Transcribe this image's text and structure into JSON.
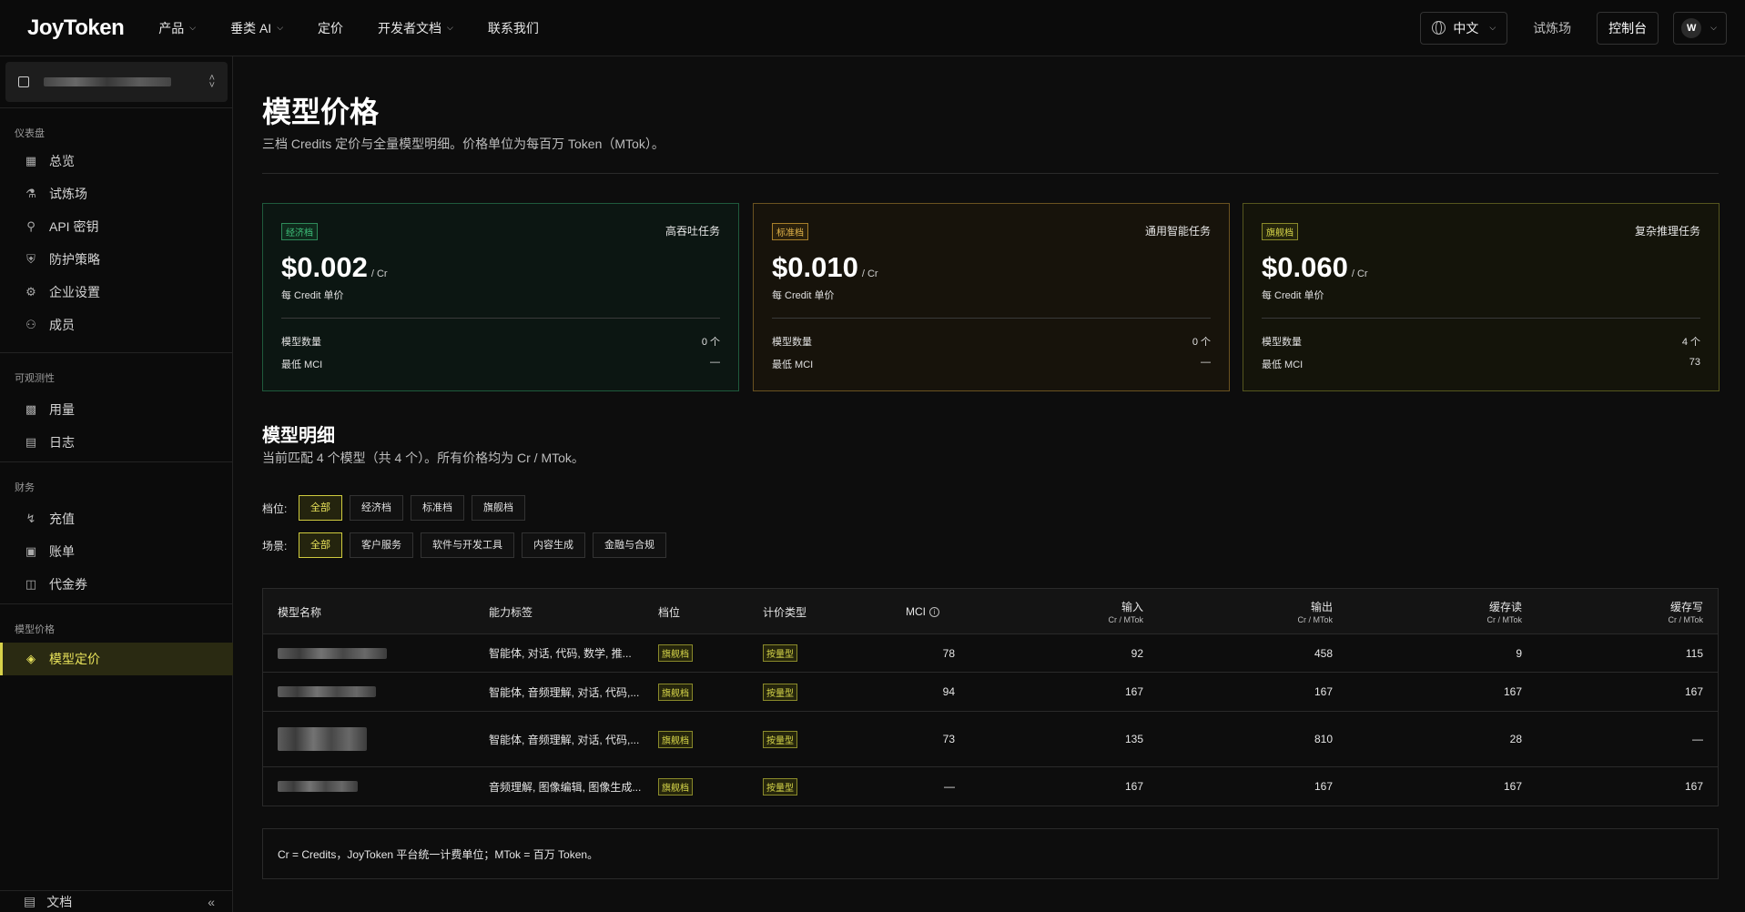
{
  "app": {
    "logo": "JoyToken"
  },
  "nav": [
    {
      "label": "产品",
      "has_menu": true
    },
    {
      "label": "垂类 AI",
      "has_menu": true
    },
    {
      "label": "定价",
      "has_menu": false
    },
    {
      "label": "开发者文档",
      "has_menu": true
    },
    {
      "label": "联系我们",
      "has_menu": false
    }
  ],
  "topright": {
    "lang": "中文",
    "playground": "试炼场",
    "console": "控制台",
    "avatar": "W"
  },
  "sidebar": {
    "groups": [
      {
        "title": "仪表盘",
        "items": [
          {
            "label": "总览",
            "icon": "grid-icon"
          },
          {
            "label": "试炼场",
            "icon": "flask-icon"
          },
          {
            "label": "API 密钥",
            "icon": "key-icon"
          },
          {
            "label": "防护策略",
            "icon": "shield-icon"
          },
          {
            "label": "企业设置",
            "icon": "gear-icon"
          },
          {
            "label": "成员",
            "icon": "users-icon"
          }
        ]
      },
      {
        "title": "可观测性",
        "items": [
          {
            "label": "用量",
            "icon": "bar-chart-icon"
          },
          {
            "label": "日志",
            "icon": "log-icon"
          }
        ]
      },
      {
        "title": "财务",
        "items": [
          {
            "label": "充值",
            "icon": "bolt-icon"
          },
          {
            "label": "账单",
            "icon": "bill-icon"
          },
          {
            "label": "代金券",
            "icon": "gift-icon"
          }
        ]
      },
      {
        "title": "模型价格",
        "items": [
          {
            "label": "模型定价",
            "icon": "tag-icon",
            "active": true
          }
        ]
      }
    ],
    "bottom": {
      "label": "文档"
    }
  },
  "page": {
    "title": "模型价格",
    "subtitle": "三档 Credits 定价与全量模型明细。价格单位为每百万 Token（MTok）。"
  },
  "tiers": [
    {
      "badge": "经济档",
      "usage": "高吞吐任务",
      "price": "$0.002",
      "unit": "/ Cr",
      "per": "每 Credit 单价",
      "count_label": "模型数量",
      "count": "0 个",
      "mci_label": "最低 MCI",
      "mci": "—",
      "color": "#3ec07a"
    },
    {
      "badge": "标准档",
      "usage": "通用智能任务",
      "price": "$0.010",
      "unit": "/ Cr",
      "per": "每 Credit 单价",
      "count_label": "模型数量",
      "count": "0 个",
      "mci_label": "最低 MCI",
      "mci": "—",
      "color": "#e4b54a"
    },
    {
      "badge": "旗舰档",
      "usage": "复杂推理任务",
      "price": "$0.060",
      "unit": "/ Cr",
      "per": "每 Credit 单价",
      "count_label": "模型数量",
      "count": "4 个",
      "mci_label": "最低 MCI",
      "mci": "73",
      "color": "#d9d84a"
    }
  ],
  "details": {
    "title": "模型明细",
    "subtitle": "当前匹配 4 个模型（共 4 个）。所有价格均为 Cr / MTok。",
    "tier_filter": {
      "label": "档位:",
      "options": [
        "全部",
        "经济档",
        "标准档",
        "旗舰档"
      ],
      "selected": 0
    },
    "scene_filter": {
      "label": "场景:",
      "options": [
        "全部",
        "客户服务",
        "软件与开发工具",
        "内容生成",
        "金融与合规"
      ],
      "selected": 0
    }
  },
  "table": {
    "headers": {
      "name": "模型名称",
      "caps": "能力标签",
      "tier": "档位",
      "ptype": "计价类型",
      "mci": "MCI",
      "input": "输入",
      "output": "输出",
      "cache_read": "缓存读",
      "cache_write": "缓存写",
      "unit": "Cr / MTok"
    },
    "rows": [
      {
        "caps": "智能体, 对话, 代码, 数学, 推...",
        "tier": "旗舰档",
        "ptype": "按量型",
        "mci": "78",
        "input": "92",
        "output": "458",
        "cache_read": "9",
        "cache_write": "115"
      },
      {
        "caps": "智能体, 音频理解, 对话, 代码,...",
        "tier": "旗舰档",
        "ptype": "按量型",
        "mci": "94",
        "input": "167",
        "output": "167",
        "cache_read": "167",
        "cache_write": "167"
      },
      {
        "caps": "智能体, 音频理解, 对话, 代码,...",
        "tier": "旗舰档",
        "ptype": "按量型",
        "mci": "73",
        "input": "135",
        "output": "810",
        "cache_read": "28",
        "cache_write": "—"
      },
      {
        "caps": "音频理解, 图像编辑, 图像生成...",
        "tier": "旗舰档",
        "ptype": "按量型",
        "mci": "—",
        "input": "167",
        "output": "167",
        "cache_read": "167",
        "cache_write": "167"
      }
    ]
  },
  "note": "Cr = Credits，JoyToken 平台统一计费单位；MTok = 百万 Token。"
}
